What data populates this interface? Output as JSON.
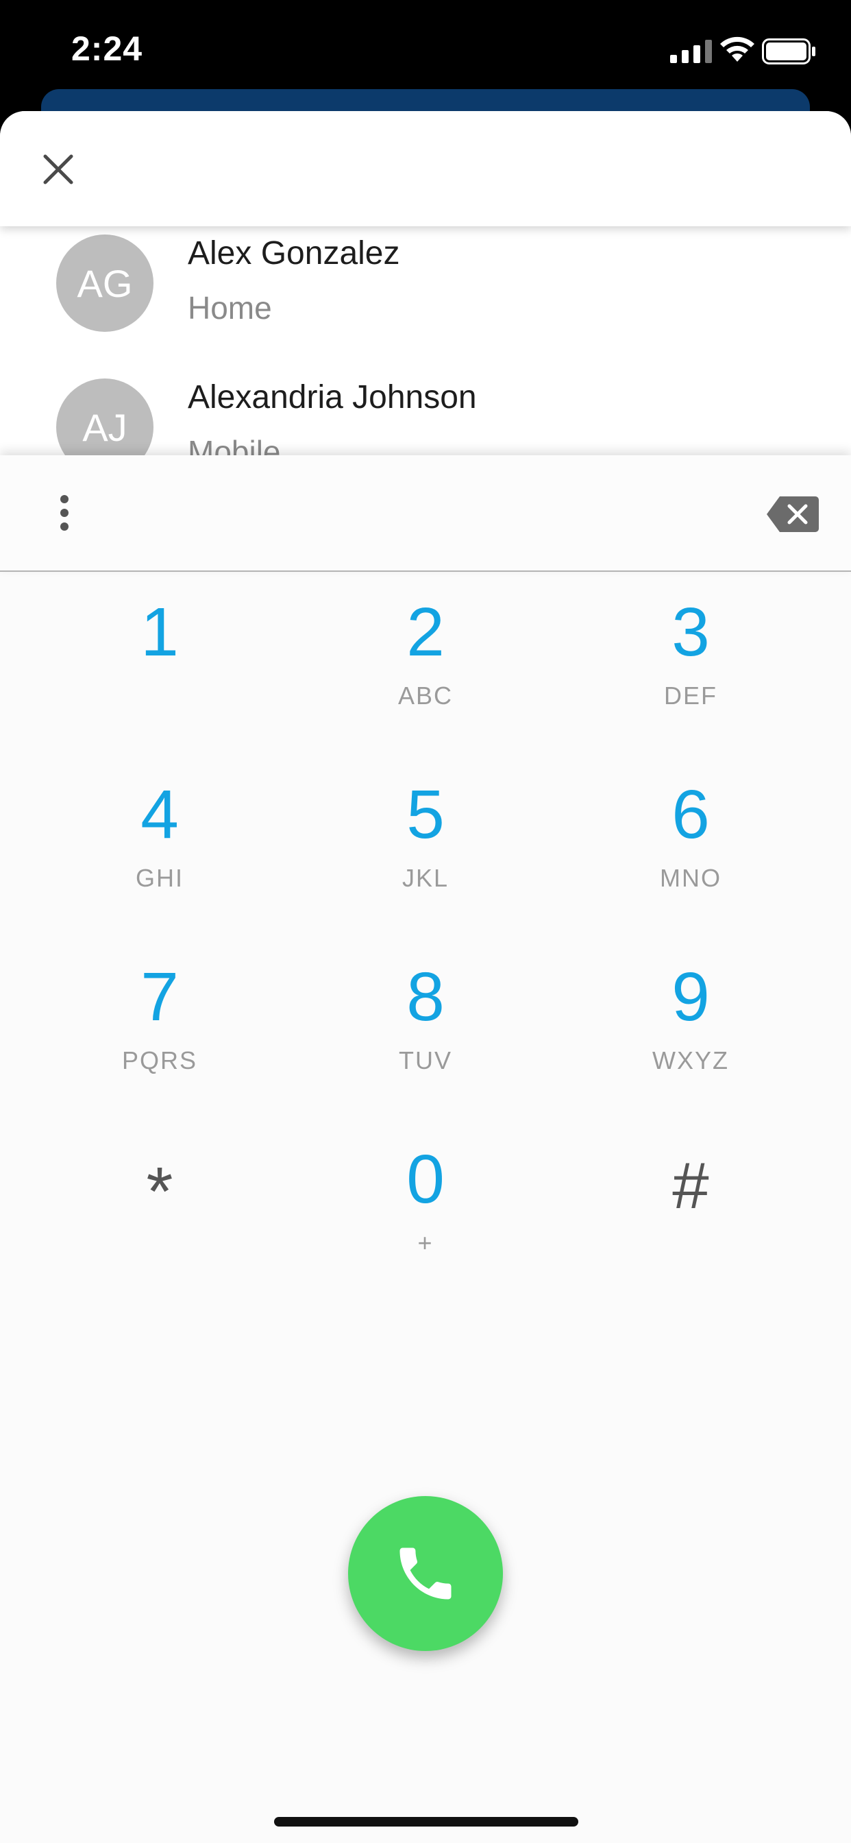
{
  "status_bar": {
    "time": "2:24"
  },
  "header": {
    "close_icon": "close-icon"
  },
  "contacts": [
    {
      "initials": "AG",
      "name": "Alex Gonzalez",
      "type": "Home"
    },
    {
      "initials": "AJ",
      "name": "Alexandria Johnson",
      "type": "Mobile"
    }
  ],
  "dialer": {
    "input_value": "",
    "more_icon": "more-vertical-icon",
    "backspace_icon": "backspace-icon",
    "keys": [
      {
        "digit": "1",
        "letters": ""
      },
      {
        "digit": "2",
        "letters": "ABC"
      },
      {
        "digit": "3",
        "letters": "DEF"
      },
      {
        "digit": "4",
        "letters": "GHI"
      },
      {
        "digit": "5",
        "letters": "JKL"
      },
      {
        "digit": "6",
        "letters": "MNO"
      },
      {
        "digit": "7",
        "letters": "PQRS"
      },
      {
        "digit": "8",
        "letters": "TUV"
      },
      {
        "digit": "9",
        "letters": "WXYZ"
      },
      {
        "digit": "*",
        "letters": ""
      },
      {
        "digit": "0",
        "letters": "+"
      },
      {
        "digit": "#",
        "letters": ""
      }
    ],
    "call_icon": "phone-icon"
  },
  "colors": {
    "accent": "#13a3e2",
    "call": "#4cd964",
    "avatar": "#bdbdbd"
  }
}
